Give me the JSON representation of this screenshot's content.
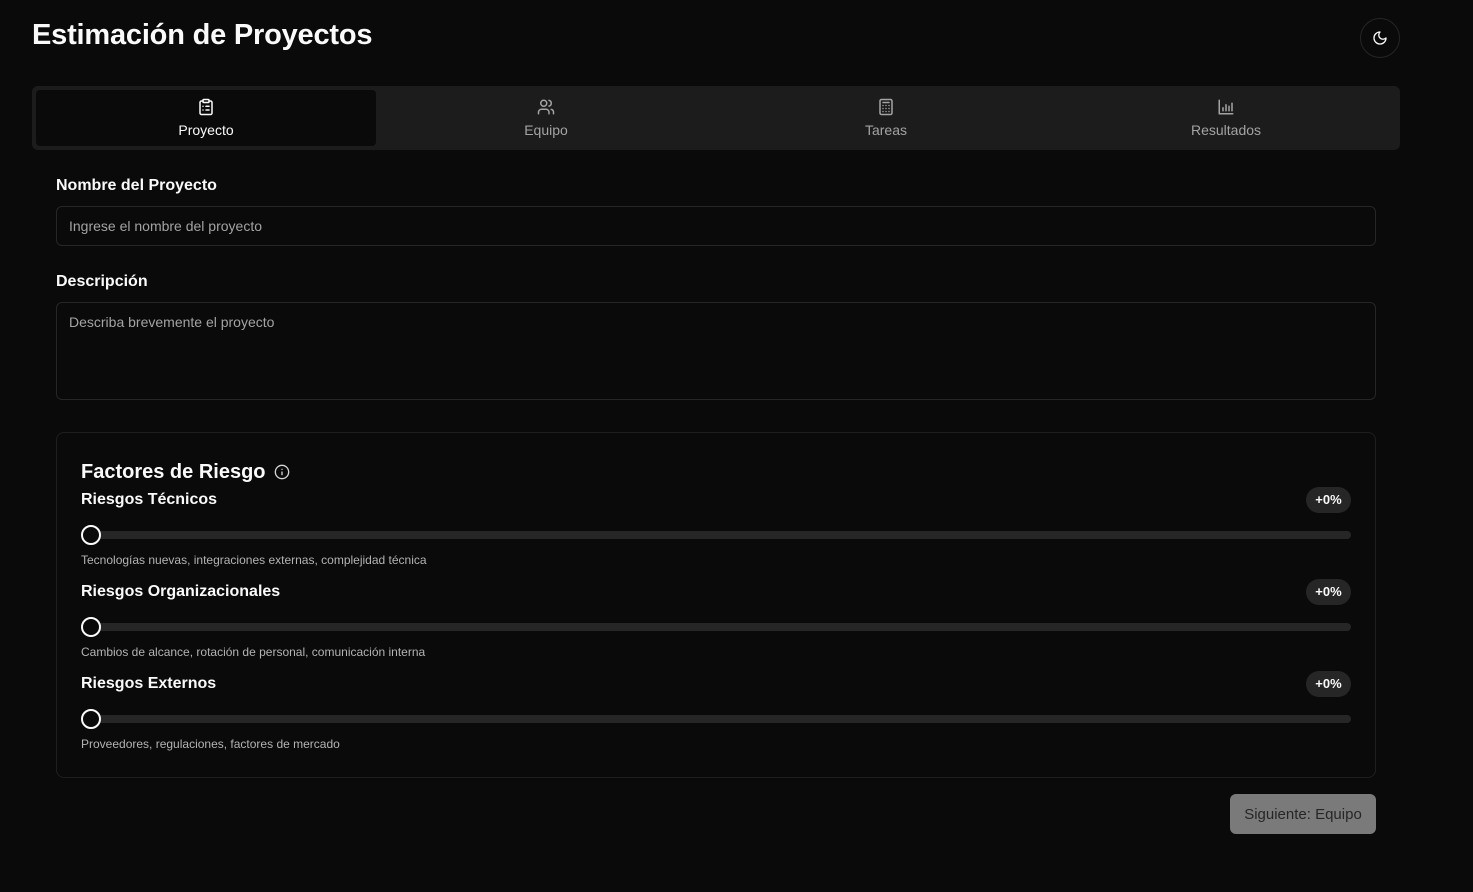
{
  "header": {
    "title": "Estimación de Proyectos",
    "theme_toggle_icon": "moon-icon"
  },
  "tabs": [
    {
      "label": "Proyecto",
      "icon": "clipboard-icon",
      "active": true
    },
    {
      "label": "Equipo",
      "icon": "users-icon",
      "active": false
    },
    {
      "label": "Tareas",
      "icon": "calculator-icon",
      "active": false
    },
    {
      "label": "Resultados",
      "icon": "bar-chart-icon",
      "active": false
    }
  ],
  "form": {
    "name_label": "Nombre del Proyecto",
    "name_placeholder": "Ingrese el nombre del proyecto",
    "name_value": "",
    "description_label": "Descripción",
    "description_placeholder": "Describa brevemente el proyecto",
    "description_value": ""
  },
  "risks": {
    "title": "Factores de Riesgo",
    "info_icon": "info-icon",
    "items": [
      {
        "name": "Riesgos Técnicos",
        "badge": "+0%",
        "value_percent": 0,
        "description": "Tecnologías nuevas, integraciones externas, complejidad técnica"
      },
      {
        "name": "Riesgos Organizacionales",
        "badge": "+0%",
        "value_percent": 0,
        "description": "Cambios de alcance, rotación de personal, comunicación interna"
      },
      {
        "name": "Riesgos Externos",
        "badge": "+0%",
        "value_percent": 0,
        "description": "Proveedores, regulaciones, factores de mercado"
      }
    ]
  },
  "footer": {
    "next_label": "Siguiente: Equipo"
  },
  "colors": {
    "background": "#0a0a0a",
    "tab_bar": "#1c1c1c",
    "border": "#262626",
    "text": "#fafafa",
    "muted_text": "#a3a3a3",
    "button_disabled": "#7a7a7a"
  }
}
